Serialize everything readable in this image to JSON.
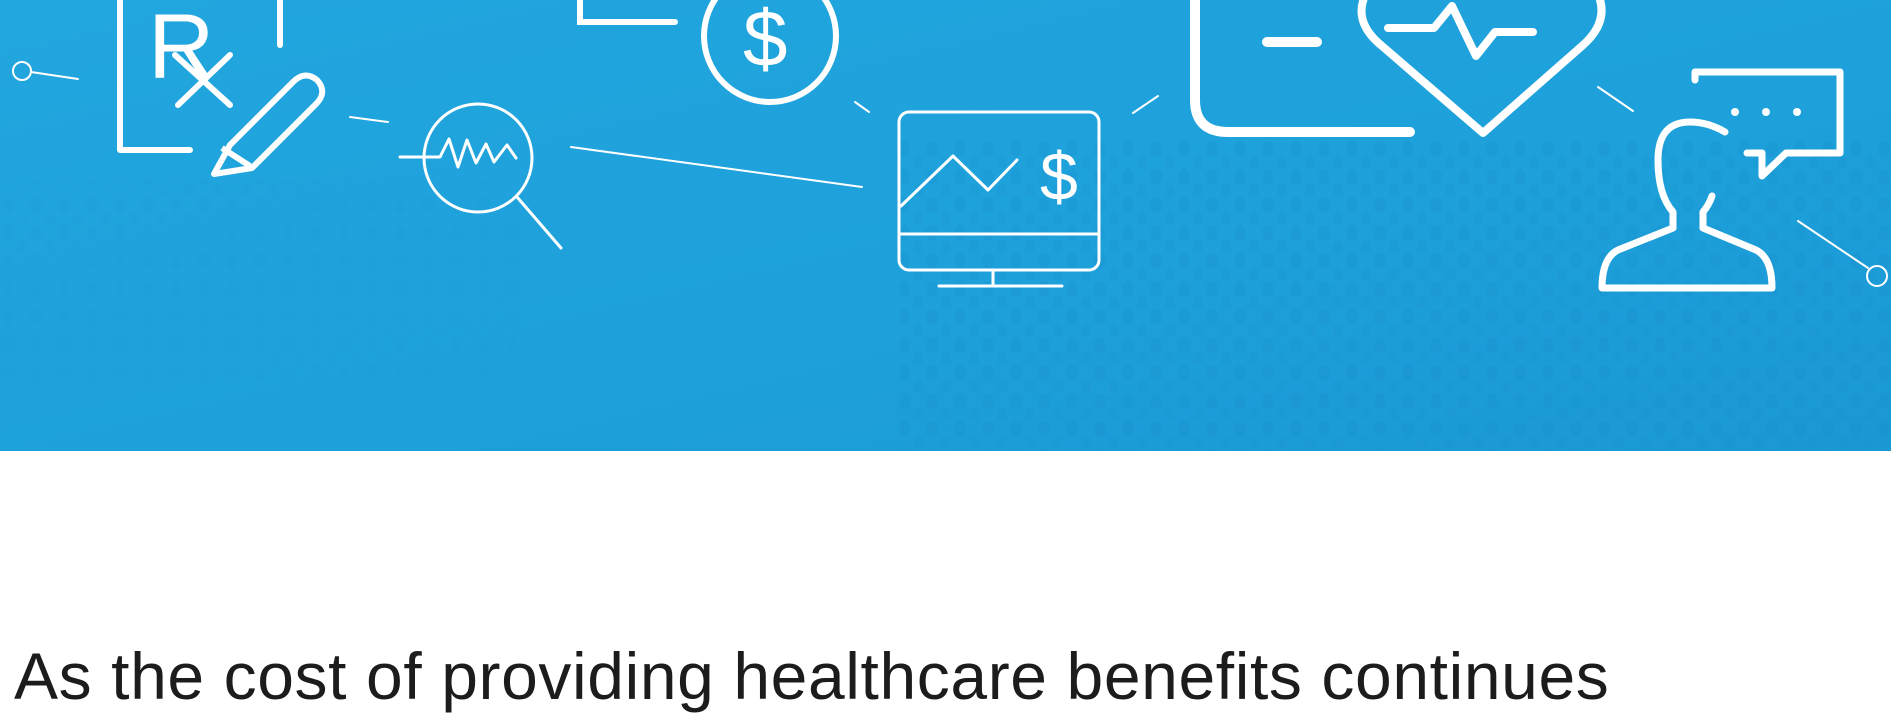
{
  "hero": {
    "background_color": "#1fa3dc",
    "accent_color": "#1690cc",
    "line_color": "#ffffff",
    "icons": [
      "prescription-pad-icon",
      "pencil-icon",
      "magnifier-pulse-icon",
      "dollar-coin-icon",
      "monitor-chart-dollar-icon",
      "clipboard-icon",
      "heart-pulse-icon",
      "user-chat-bubble-icon"
    ],
    "glyphs": {
      "rx": "R",
      "dollar": "$"
    }
  },
  "intro": {
    "text": "As the cost of providing healthcare benefits continues"
  }
}
